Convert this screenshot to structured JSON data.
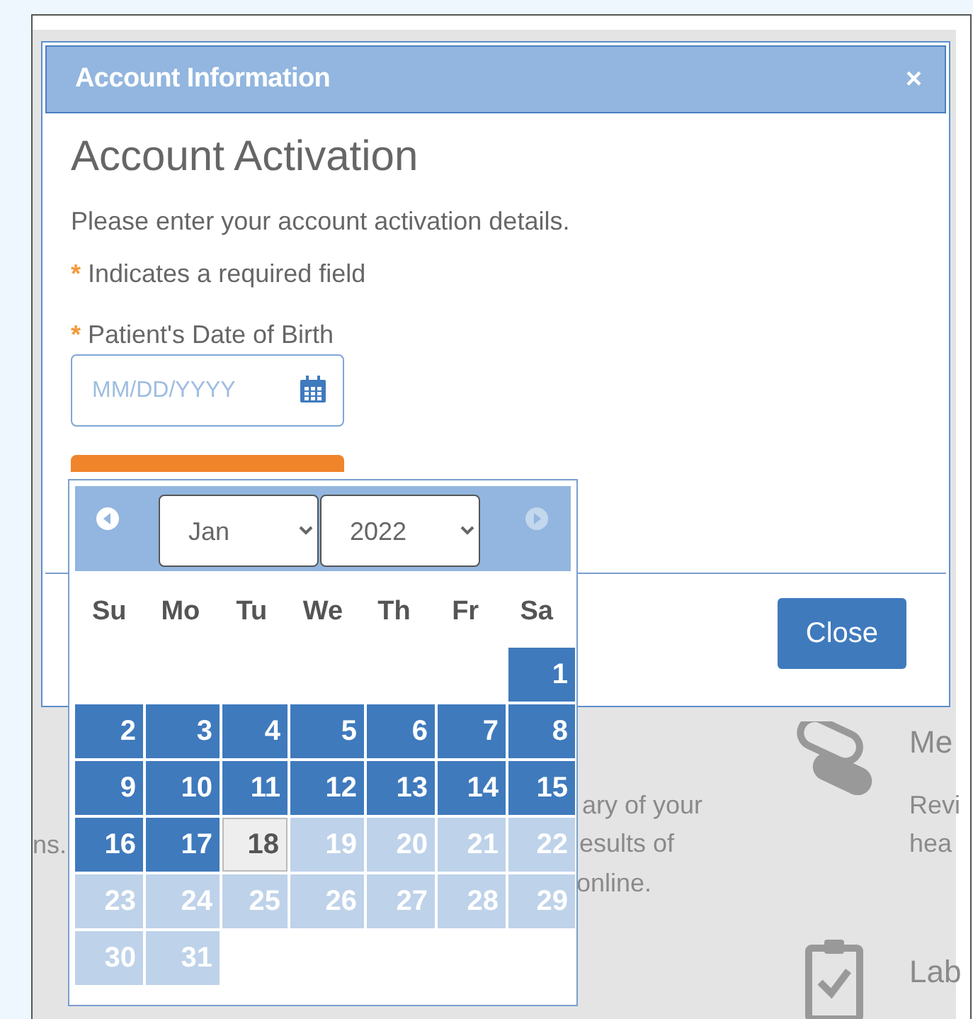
{
  "background_page": {
    "fragments": [
      {
        "text": "ns.",
        "kind": "body"
      },
      {
        "text": "ary of your",
        "kind": "body"
      },
      {
        "text": "esults of",
        "kind": "body"
      },
      {
        "text": "online.",
        "kind": "body"
      },
      {
        "text": "Me",
        "kind": "heading"
      },
      {
        "text": "Revi",
        "kind": "body"
      },
      {
        "text": "hea",
        "kind": "body"
      },
      {
        "text": "Lab",
        "kind": "heading"
      }
    ]
  },
  "dialog": {
    "title": "Account Information",
    "close_glyph": "×",
    "heading": "Account Activation",
    "intro": "Please enter your account activation details.",
    "required_mark": "*",
    "required_note": "Indicates a required field",
    "field": {
      "label": "Patient's Date of Birth",
      "required": true,
      "placeholder": "MM/DD/YYYY"
    },
    "footer_button": "Close"
  },
  "datepicker": {
    "month": "Jan",
    "year": "2022",
    "prev_enabled": true,
    "next_enabled": false,
    "weekdays": [
      "Su",
      "Mo",
      "Tu",
      "We",
      "Th",
      "Fr",
      "Sa"
    ],
    "weeks": [
      [
        {
          "kind": "empty"
        },
        {
          "kind": "empty"
        },
        {
          "kind": "empty"
        },
        {
          "kind": "empty"
        },
        {
          "kind": "empty"
        },
        {
          "kind": "empty"
        },
        {
          "label": "1",
          "kind": "enabled"
        }
      ],
      [
        {
          "label": "2",
          "kind": "enabled"
        },
        {
          "label": "3",
          "kind": "enabled"
        },
        {
          "label": "4",
          "kind": "enabled"
        },
        {
          "label": "5",
          "kind": "enabled"
        },
        {
          "label": "6",
          "kind": "enabled"
        },
        {
          "label": "7",
          "kind": "enabled"
        },
        {
          "label": "8",
          "kind": "enabled"
        }
      ],
      [
        {
          "label": "9",
          "kind": "enabled"
        },
        {
          "label": "10",
          "kind": "enabled"
        },
        {
          "label": "11",
          "kind": "enabled"
        },
        {
          "label": "12",
          "kind": "enabled"
        },
        {
          "label": "13",
          "kind": "enabled"
        },
        {
          "label": "14",
          "kind": "enabled"
        },
        {
          "label": "15",
          "kind": "enabled"
        }
      ],
      [
        {
          "label": "16",
          "kind": "enabled"
        },
        {
          "label": "17",
          "kind": "enabled"
        },
        {
          "label": "18",
          "kind": "today"
        },
        {
          "label": "19",
          "kind": "disabled"
        },
        {
          "label": "20",
          "kind": "disabled"
        },
        {
          "label": "21",
          "kind": "disabled"
        },
        {
          "label": "22",
          "kind": "disabled"
        }
      ],
      [
        {
          "label": "23",
          "kind": "disabled"
        },
        {
          "label": "24",
          "kind": "disabled"
        },
        {
          "label": "25",
          "kind": "disabled"
        },
        {
          "label": "26",
          "kind": "disabled"
        },
        {
          "label": "27",
          "kind": "disabled"
        },
        {
          "label": "28",
          "kind": "disabled"
        },
        {
          "label": "29",
          "kind": "disabled"
        }
      ],
      [
        {
          "label": "30",
          "kind": "disabled"
        },
        {
          "label": "31",
          "kind": "disabled"
        },
        {
          "kind": "empty"
        },
        {
          "kind": "empty"
        },
        {
          "kind": "empty"
        },
        {
          "kind": "empty"
        },
        {
          "kind": "empty"
        }
      ]
    ]
  }
}
